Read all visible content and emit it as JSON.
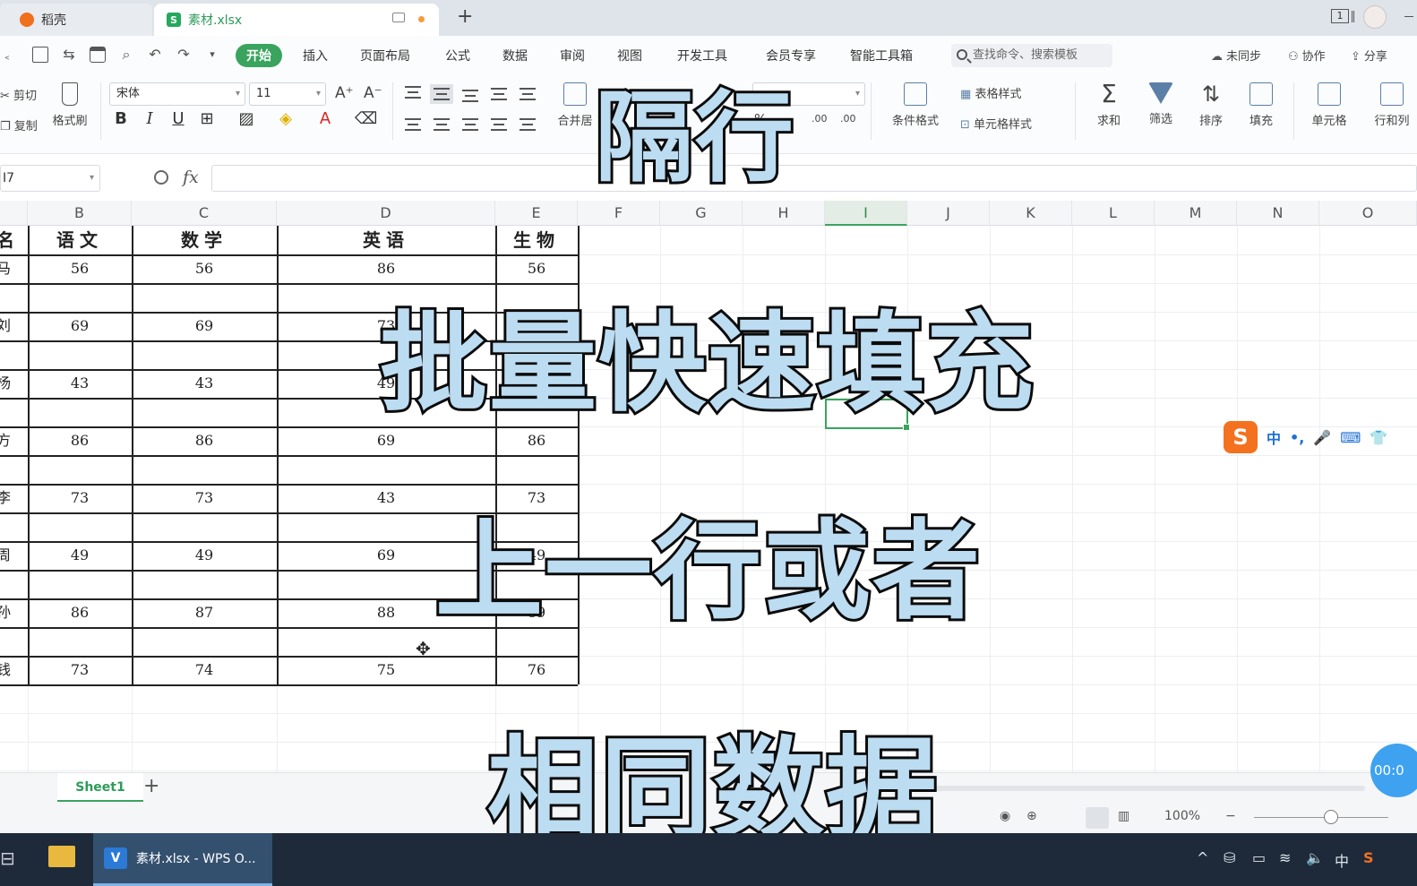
{
  "tabs": {
    "docer": "稻壳",
    "file": "素材.xlsx",
    "add": "+"
  },
  "window": {
    "tab_count": "1"
  },
  "menu": {
    "start": "开始",
    "items": [
      "插入",
      "页面布局",
      "公式",
      "数据",
      "审阅",
      "视图",
      "开发工具",
      "会员专享",
      "智能工具箱"
    ],
    "search_placeholder": "查找命令、搜索模板",
    "right": {
      "unsynced": "未同步",
      "collab": "协作",
      "share": "分享"
    }
  },
  "ribbon": {
    "cut": "剪切",
    "copy": "复制",
    "format_painter": "格式刷",
    "font": "宋体",
    "font_size": "11",
    "grow_font": "A⁺",
    "shrink_font": "A⁻",
    "bold": "B",
    "italic": "I",
    "underline": "U",
    "merge": "合并居",
    "cond_format": "条件格式",
    "table_style": "表格样式",
    "cell_style": "单元格样式",
    "sum": "求和",
    "filter": "筛选",
    "sort": "排序",
    "fill": "填充",
    "cell": "单元格",
    "row_col": "行和列",
    "percent": "%",
    "dec_inc": ".00",
    "dec_dec": ".00"
  },
  "formula_bar": {
    "name_box": "I7",
    "fx": "fx",
    "value": ""
  },
  "columns": [
    "B",
    "C",
    "D",
    "E",
    "F",
    "G",
    "H",
    "I",
    "J",
    "K",
    "L",
    "M",
    "N",
    "O"
  ],
  "table": {
    "headers": [
      "名",
      "语文",
      "数学",
      "英语",
      "生物"
    ],
    "rows": [
      [
        "马",
        "56",
        "56",
        "86",
        "56"
      ],
      [
        "",
        "",
        "",
        "",
        ""
      ],
      [
        "刘",
        "69",
        "69",
        "73",
        "69"
      ],
      [
        "",
        "",
        "",
        "",
        ""
      ],
      [
        "杨",
        "43",
        "43",
        "49",
        "43"
      ],
      [
        "",
        "",
        "",
        "",
        ""
      ],
      [
        "方",
        "86",
        "86",
        "69",
        "86"
      ],
      [
        "",
        "",
        "",
        "",
        ""
      ],
      [
        "李",
        "73",
        "73",
        "43",
        "73"
      ],
      [
        "",
        "",
        "",
        "",
        ""
      ],
      [
        "周",
        "49",
        "49",
        "69",
        "49"
      ],
      [
        "",
        "",
        "",
        "",
        ""
      ],
      [
        "孙",
        "86",
        "87",
        "88",
        "89"
      ],
      [
        "",
        "",
        "",
        "",
        ""
      ],
      [
        "钱",
        "73",
        "74",
        "75",
        "76"
      ]
    ]
  },
  "overlay": [
    "隔行",
    "批量快速填充",
    "上一行或者",
    "相同数据"
  ],
  "ime": {
    "logo": "S",
    "mode": "中",
    "punct": "•,",
    "mic": "🎤",
    "kbd": "⌨",
    "skin": "👕"
  },
  "sheet": {
    "tab": "Sheet1",
    "add": "+"
  },
  "status": {
    "zoom": "100%",
    "zoom_minus": "−",
    "timer": "00:0"
  },
  "taskbar": {
    "app": "素材.xlsx - WPS O...",
    "app_icon": "V",
    "lang": "中",
    "tray_up": "^"
  },
  "colors": {
    "accent": "#3aa45e",
    "overlay_fill": "#bcdcf1",
    "overlay_stroke": "#0b0b0b",
    "taskbar": "#1e2a39"
  }
}
